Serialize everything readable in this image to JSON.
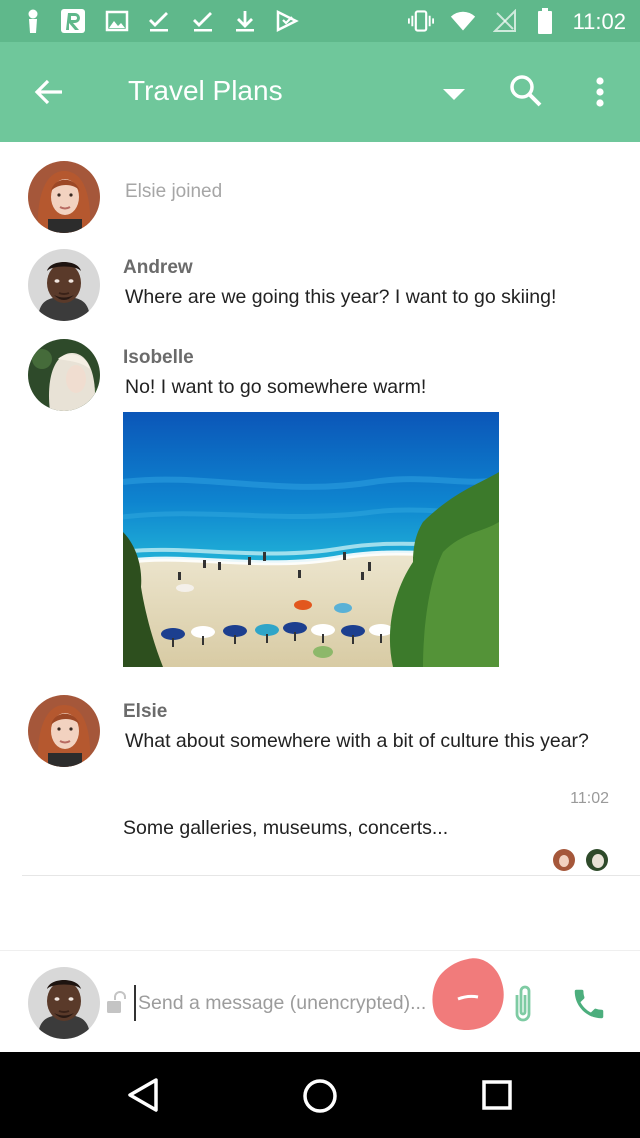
{
  "status_bar": {
    "time": "11:02",
    "icons": [
      "person-notification-icon",
      "r-app-icon",
      "image-icon",
      "check-icon",
      "check-icon",
      "download-icon",
      "send-icon",
      "vibrate-icon",
      "wifi-icon",
      "no-signal-icon",
      "battery-icon"
    ]
  },
  "app_bar": {
    "title": "Travel Plans",
    "background": "#6fc79b"
  },
  "messages": {
    "system": {
      "text": "Elsie joined"
    },
    "andrew": {
      "sender": "Andrew",
      "text": "Where are we going this year? I want to go skiing!"
    },
    "isobelle": {
      "sender": "Isobelle",
      "text": "No! I want to go somewhere warm!"
    },
    "elsie": {
      "sender": "Elsie",
      "text": "What about somewhere with a bit of culture this year?",
      "time": "11:02",
      "followup": "Some galleries, museums, concerts..."
    }
  },
  "composer": {
    "placeholder": "Send a message (unencrypted)..."
  },
  "colors": {
    "status_bar": "#5fb88b",
    "accent": "#6fc79b",
    "call_icon": "#4cae7d",
    "annotation": "#f06d6d"
  }
}
